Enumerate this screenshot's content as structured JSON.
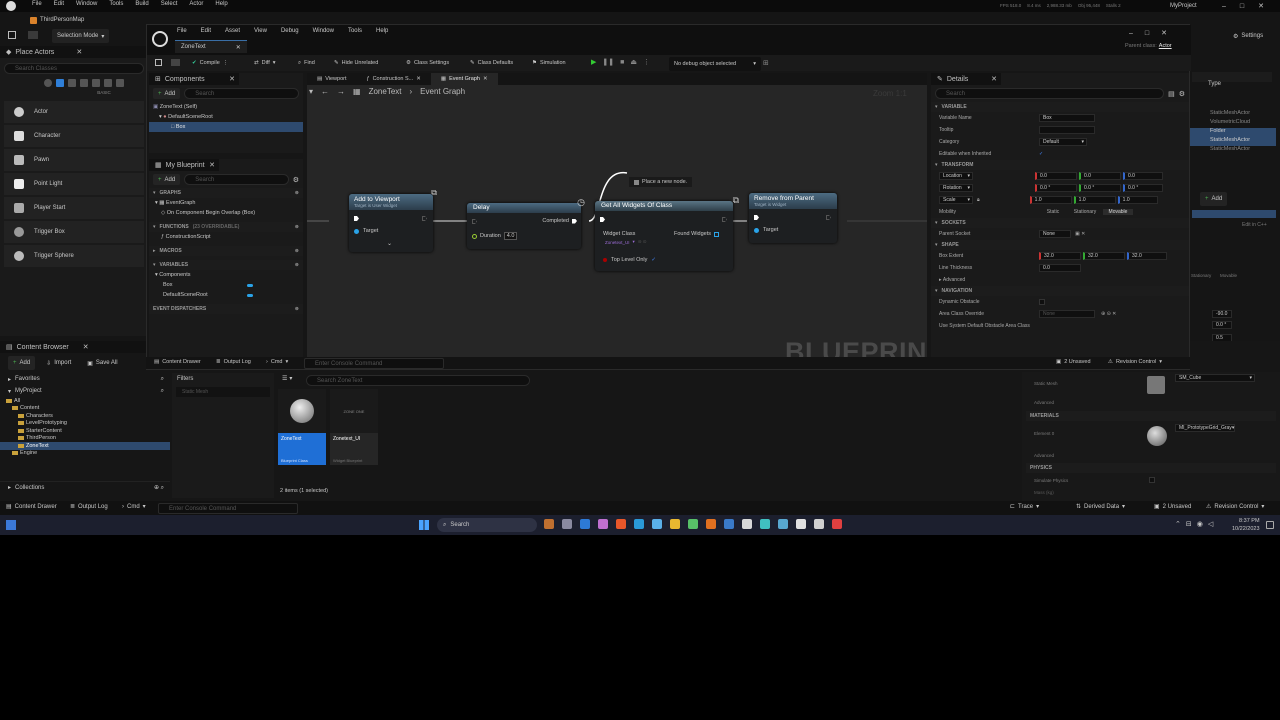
{
  "main": {
    "menu": [
      "File",
      "Edit",
      "Window",
      "Tools",
      "Build",
      "Select",
      "Actor",
      "Help"
    ],
    "map_tab": "ThirdPersonMap",
    "stats": [
      "FPS 518.0",
      "8.4 ms",
      "2,988.33 mb",
      "Obj 95,448",
      "Stalls 2"
    ],
    "project": "MyProject",
    "selection_mode": "Selection Mode",
    "settings": "Settings",
    "place_actors": {
      "title": "Place Actors",
      "search_placeholder": "Search Classes",
      "category": "BASIC",
      "items": [
        "Actor",
        "Character",
        "Pawn",
        "Point Light",
        "Player Start",
        "Trigger Box",
        "Trigger Sphere"
      ]
    },
    "outliner": {
      "type_header": "Type",
      "types": [
        "StaticMeshActor",
        "VolumetricCloud",
        "Folder",
        "StaticMeshActor",
        "StaticMeshActor"
      ],
      "add": "Add",
      "edit_cpp": "Edit in C++",
      "mobility": [
        "Stationary",
        "Movable"
      ],
      "mobility_short": [
        "Stationary",
        "Movable"
      ]
    },
    "content_browser": {
      "tab": "Content Browser",
      "add": "Add",
      "import": "Import",
      "save_all": "Save All",
      "favorites": "Favorites",
      "project": "MyProject",
      "tree": [
        "All",
        "Content",
        "Characters",
        "LevelPrototyping",
        "StarterContent",
        "ThirdPerson",
        "ZoneText",
        "Engine"
      ],
      "collections": "Collections",
      "filters": "Filters",
      "static_mesh": "Static Mesh",
      "search_placeholder": "Search ZoneText",
      "assets": [
        {
          "name": "ZoneText",
          "type": "Blueprint Class",
          "thumb": ""
        },
        {
          "name": "Zonetext_UI",
          "type": "Widget Blueprint",
          "thumb": "ZONE ONE"
        }
      ],
      "status": "2 items (1 selected)"
    },
    "bottom_bar": {
      "content_drawer": "Content Drawer",
      "output_log": "Output Log",
      "cmd": "Cmd",
      "console_placeholder": "Enter Console Command",
      "trace": "Trace",
      "derived_data": "Derived Data",
      "unsaved": "2 Unsaved",
      "revision": "Revision Control"
    },
    "details_right": {
      "static_mesh_label": "Static Mesh",
      "static_mesh_value": "SM_Cube",
      "advanced": "Advanced",
      "materials": "Materials",
      "element": "Element 0",
      "material_value": "MI_PrototypeGrid_Gray",
      "physics": "Physics",
      "simulate": "Simulate Physics",
      "mass": "Mass (kg)"
    }
  },
  "bp": {
    "menu": [
      "File",
      "Edit",
      "Asset",
      "View",
      "Debug",
      "Window",
      "Tools",
      "Help"
    ],
    "tab": "ZoneText",
    "parent_class_label": "Parent class:",
    "parent_class": "Actor",
    "toolbar": {
      "compile": "Compile",
      "diff": "Diff",
      "find": "Find",
      "hide_unrelated": "Hide Unrelated",
      "class_settings": "Class Settings",
      "class_defaults": "Class Defaults",
      "simulation": "Simulation",
      "debug_object": "No debug object selected"
    },
    "components": {
      "title": "Components",
      "add": "Add",
      "search": "Search",
      "items": [
        "ZoneText (Self)",
        "DefaultSceneRoot",
        "Box"
      ]
    },
    "my_blueprint": {
      "title": "My Blueprint",
      "add": "Add",
      "search": "Search",
      "graphs": "GRAPHS",
      "event_graph": "EventGraph",
      "overlap_event": "On Component Begin Overlap (Box)",
      "functions": "FUNCTIONS",
      "functions_count": "(23 OVERRIDABLE)",
      "construction": "ConstructionScript",
      "macros": "MACROS",
      "variables": "VARIABLES",
      "components_cat": "Components",
      "vars": [
        "Box",
        "DefaultSceneRoot"
      ],
      "dispatchers": "EVENT DISPATCHERS"
    },
    "graph_tabs": [
      "Viewport",
      "Construction S...",
      "Event Graph"
    ],
    "breadcrumb": [
      "ZoneText",
      "Event Graph"
    ],
    "zoom": "Zoom 1:1",
    "watermark": "BLUEPRINT",
    "nodes": {
      "add_viewport": {
        "title": "Add to Viewport",
        "sub": "Target is User Widget",
        "pin": "Target"
      },
      "delay": {
        "title": "Delay",
        "duration_label": "Duration",
        "duration": "4.0",
        "completed": "Completed"
      },
      "get_widgets": {
        "title": "Get All Widgets Of Class",
        "widget_class": "Widget Class",
        "class_value": "Zonetext_UI",
        "found": "Found Widgets",
        "top_level": "Top Level Only"
      },
      "remove_parent": {
        "title": "Remove from Parent",
        "sub": "Target is Widget",
        "pin": "Target"
      },
      "place_node": "Place a new node."
    },
    "details": {
      "title": "Details",
      "search": "Search",
      "variable": "VARIABLE",
      "variable_name_label": "Variable Name",
      "variable_name": "Box",
      "tooltip": "Tooltip",
      "category_label": "Category",
      "category": "Default",
      "editable": "Editable when Inherited",
      "transform": "TRANSFORM",
      "location": "Location",
      "rotation": "Rotation",
      "scale": "Scale",
      "loc_vals": [
        "0.0",
        "0.0",
        "0.0"
      ],
      "rot_vals": [
        "0.0 °",
        "0.0 °",
        "0.0 °"
      ],
      "scale_vals": [
        "1.0",
        "1.0",
        "1.0"
      ],
      "mobility": "Mobility",
      "mobility_opts": [
        "Static",
        "Stationary",
        "Movable"
      ],
      "sockets": "SOCKETS",
      "parent_socket": "Parent Socket",
      "socket_val": "None",
      "shape": "SHAPE",
      "box_extent": "Box Extent",
      "extent_vals": [
        "32.0",
        "32.0",
        "32.0"
      ],
      "line_thickness": "Line Thickness",
      "line_val": "0.0",
      "advanced": "Advanced",
      "navigation": "NAVIGATION",
      "dynamic_obstacle": "Dynamic Obstacle",
      "area_class": "Area Class Override",
      "area_val": "None",
      "use_system": "Use System Default Obstacle Area Class"
    },
    "bottom": {
      "content_drawer": "Content Drawer",
      "output_log": "Output Log",
      "cmd": "Cmd",
      "console": "Enter Console Command",
      "unsaved": "2 Unsaved",
      "revision": "Revision Control"
    }
  },
  "taskbar": {
    "search": "Search",
    "time": "8:37 PM",
    "date": "10/22/2023"
  },
  "right_numbers": [
    "-90.0",
    "0.0 °",
    "0.5"
  ]
}
